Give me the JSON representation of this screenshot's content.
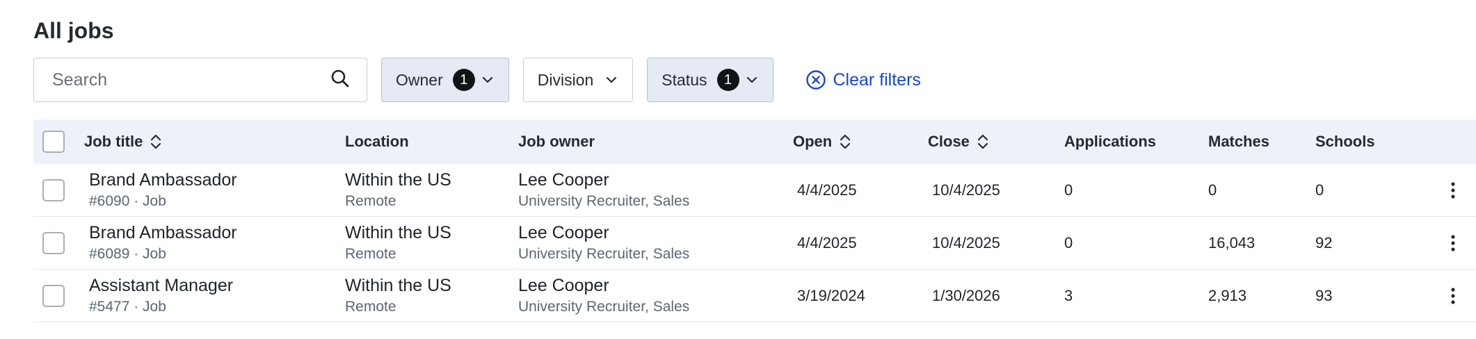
{
  "page": {
    "title": "All jobs"
  },
  "filters": {
    "search_placeholder": "Search",
    "owner": {
      "label": "Owner",
      "count": "1"
    },
    "division": {
      "label": "Division"
    },
    "status": {
      "label": "Status",
      "count": "1"
    },
    "clear_label": "Clear filters"
  },
  "table": {
    "headers": {
      "job_title": "Job title",
      "location": "Location",
      "job_owner": "Job owner",
      "open": "Open",
      "close": "Close",
      "applications": "Applications",
      "matches": "Matches",
      "schools": "Schools"
    },
    "rows": [
      {
        "title": "Brand Ambassador",
        "meta": "#6090 · Job",
        "location": "Within the US",
        "location_type": "Remote",
        "owner": "Lee Cooper",
        "owner_role": "University Recruiter, Sales",
        "open": "4/4/2025",
        "close": "10/4/2025",
        "applications": "0",
        "matches": "0",
        "schools": "0"
      },
      {
        "title": "Brand Ambassador",
        "meta": "#6089 · Job",
        "location": "Within the US",
        "location_type": "Remote",
        "owner": "Lee Cooper",
        "owner_role": "University Recruiter, Sales",
        "open": "4/4/2025",
        "close": "10/4/2025",
        "applications": "0",
        "matches": "16,043",
        "schools": "92"
      },
      {
        "title": "Assistant Manager",
        "meta": "#5477 · Job",
        "location": "Within the US",
        "location_type": "Remote",
        "owner": "Lee Cooper",
        "owner_role": "University Recruiter, Sales",
        "open": "3/19/2024",
        "close": "1/30/2026",
        "applications": "3",
        "matches": "2,913",
        "schools": "93"
      }
    ]
  },
  "colors": {
    "accent": "#1a47c7",
    "header_bg": "#eef1f9",
    "active_filter_bg": "#e6eaf5",
    "badge": "#111417"
  },
  "icons": {
    "search": "search-icon",
    "chevron": "chevron-down-icon",
    "clear": "x-circle-icon",
    "sort": "sort-icon",
    "row_menu": "more-vertical-icon"
  }
}
